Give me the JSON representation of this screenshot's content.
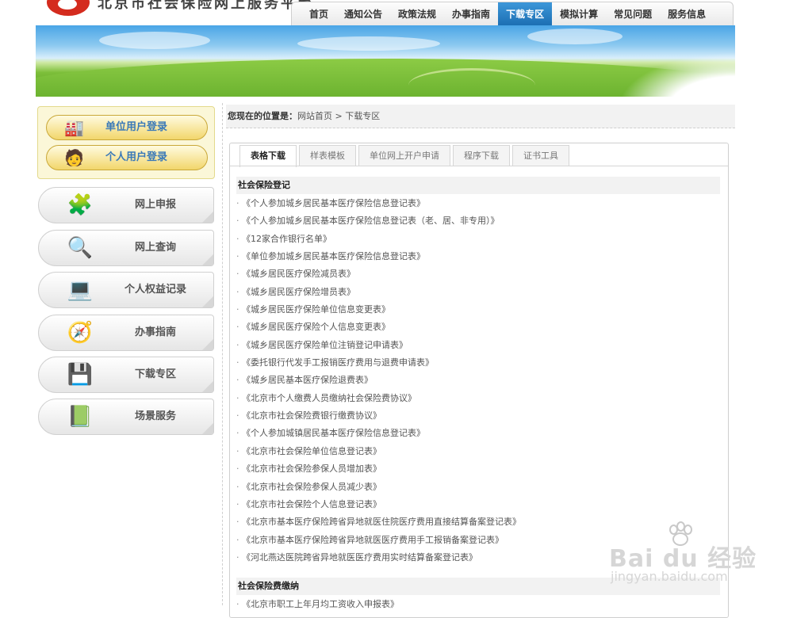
{
  "header": {
    "site_title": "北京市社会保险网上服务平台",
    "nav": [
      "首页",
      "通知公告",
      "政策法规",
      "办事指南",
      "下载专区",
      "模拟计算",
      "常见问题",
      "服务信息"
    ],
    "nav_active": "下载专区"
  },
  "sidebar": {
    "login": [
      {
        "label": "单位用户登录",
        "icon": "factory-icon"
      },
      {
        "label": "个人用户登录",
        "icon": "person-icon"
      }
    ],
    "items": [
      {
        "label": "网上申报",
        "icon": "blocks-icon"
      },
      {
        "label": "网上查询",
        "icon": "magnifier-icon"
      },
      {
        "label": "个人权益记录",
        "icon": "computer-icon"
      },
      {
        "label": "办事指南",
        "icon": "signpost-icon"
      },
      {
        "label": "下载专区",
        "icon": "floppy-icon"
      },
      {
        "label": "场景服务",
        "icon": "book-icon"
      }
    ]
  },
  "breadcrumb": {
    "prefix": "您现在的位置是：",
    "home": "网站首页",
    "separator": " > ",
    "current": "下载专区"
  },
  "tabs": [
    "表格下载",
    "样表模板",
    "单位网上开户申请",
    "程序下载",
    "证书工具"
  ],
  "active_tab": "表格下载",
  "sections": [
    {
      "title": "社会保险登记",
      "items": [
        "《个人参加城乡居民基本医疗保险信息登记表》",
        "《个人参加城乡居民基本医疗保险信息登记表（老、居、非专用）》",
        "《12家合作银行名单》",
        "《单位参加城乡居民基本医疗保险信息登记表》",
        "《城乡居民医疗保险减员表》",
        "《城乡居民医疗保险增员表》",
        "《城乡居民医疗保险单位信息变更表》",
        "《城乡居民医疗保险个人信息变更表》",
        "《城乡居民医疗保险单位注销登记申请表》",
        "《委托银行代发手工报销医疗费用与退费申请表》",
        "《城乡居民基本医疗保险退费表》",
        "《北京市个人缴费人员缴纳社会保险费协议》",
        "《北京市社会保险费银行缴费协议》",
        "《个人参加城镇居民基本医疗保险信息登记表》",
        "《北京市社会保险单位信息登记表》",
        "《北京市社会保险参保人员增加表》",
        "《北京市社会保险参保人员减少表》",
        "《北京市社会保险个人信息登记表》",
        "《北京市基本医疗保险跨省异地就医住院医疗费用直接结算备案登记表》",
        "《北京市基本医疗保险跨省异地就医医疗费用手工报销备案登记表》",
        "《河北燕达医院跨省异地就医医疗费用实时结算备案登记表》"
      ]
    },
    {
      "title": "社会保险费缴纳",
      "items": [
        "《北京市职工上年月均工资收入申报表》"
      ]
    }
  ],
  "watermark": {
    "logo_text": "Bai du 经验",
    "url": "jingyan.baidu.com"
  },
  "colors": {
    "nav_active": "#1f74b8",
    "login_box_bg": "#fbf7d8",
    "login_label": "#3a79b8",
    "section_bg": "#f2f2f2"
  }
}
